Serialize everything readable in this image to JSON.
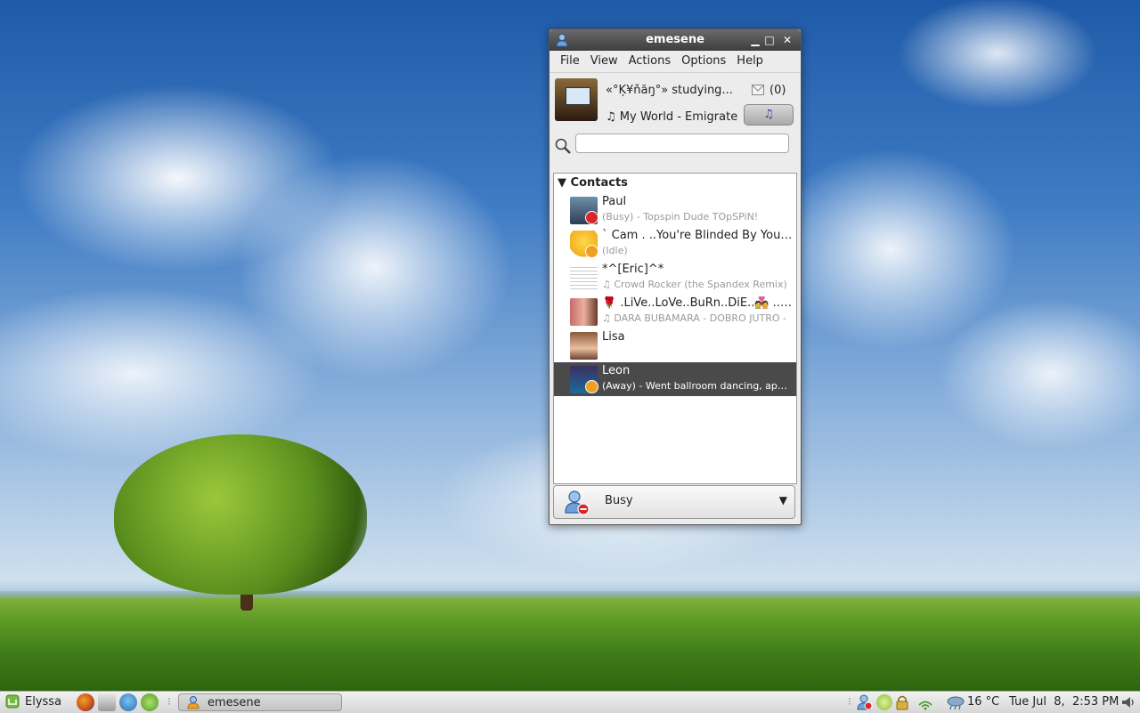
{
  "window": {
    "title": "emesene",
    "min_glyph": "▁",
    "max_glyph": "□",
    "close_glyph": "✕"
  },
  "menu": {
    "file": "File",
    "view": "View",
    "actions": "Actions",
    "options": "Options",
    "help": "Help"
  },
  "profile": {
    "nick": "«°Ķ¥ňăŋ°» studying...",
    "mail_count": "(0)",
    "psm": "♫ My World - Emigrate",
    "music_glyph": "♫"
  },
  "search": {
    "value": "",
    "placeholder": ""
  },
  "contacts": {
    "group_label": "Contacts",
    "group_arrow": "▼",
    "items": [
      {
        "name": "Paul",
        "message": "(Busy) - Topspin Dude TOpSPiN!",
        "status": "busy"
      },
      {
        "name": "` Cam .  ..You're Blinded By Your Own Stupidity",
        "message": "(Idle)",
        "status": "idle"
      },
      {
        "name": "*^[Eric]^*",
        "message": "♫ Crowd Rocker (the Spandex Remix)",
        "status": "online"
      },
      {
        "name": "🌹 .LiVe..LoVe..BuRn..DiE..💑 ..S...",
        "message": "♫ DARA BUBAMARA - DOBRO JUTRO -",
        "status": "online"
      },
      {
        "name": "Lisa",
        "message": "",
        "status": "online"
      },
      {
        "name": "Leon",
        "message": "(Away) - Went ballroom dancing, appearing...",
        "status": "away"
      }
    ]
  },
  "status_selector": {
    "label": "Busy",
    "arrow": "▼"
  },
  "taskbar": {
    "menu_label": "Elyssa",
    "task_label": "emesene",
    "separator_glyph": "⁝",
    "temperature": "16 °C",
    "clock": "Tue Jul  8,  2:53 PM"
  },
  "colors": {
    "busy": "#d8262b",
    "idle": "#f0a020",
    "away": "#f0a020",
    "selected_row": "#4a4a4a",
    "titlebar": "#3e3e3e",
    "accent": "#2a4a9a"
  },
  "icons": {
    "app": "user-icon",
    "mail": "envelope-icon",
    "music": "music-note-icon",
    "search": "magnifier-icon",
    "status": "user-busy-icon"
  }
}
